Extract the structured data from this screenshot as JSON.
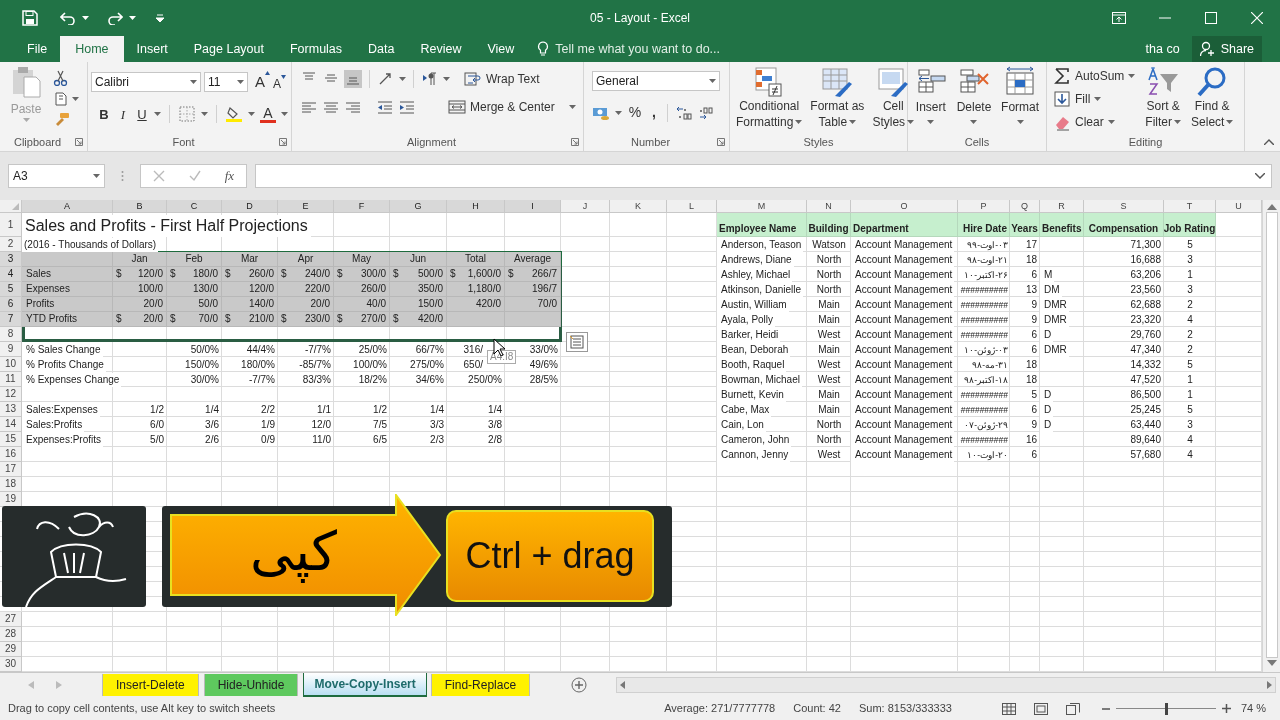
{
  "window": {
    "title": "05 - Layout - Excel"
  },
  "tabs": [
    {
      "label": "File",
      "selected": false
    },
    {
      "label": "Home",
      "selected": true
    },
    {
      "label": "Insert",
      "selected": false
    },
    {
      "label": "Page Layout",
      "selected": false
    },
    {
      "label": "Formulas",
      "selected": false
    },
    {
      "label": "Data",
      "selected": false
    },
    {
      "label": "Review",
      "selected": false
    },
    {
      "label": "View",
      "selected": false
    }
  ],
  "tell_me": {
    "placeholder": "Tell me what you want to do..."
  },
  "user": "tha co",
  "share": "Share",
  "ribbon": {
    "clipboard": {
      "label": "Clipboard",
      "paste": {
        "label": "Paste",
        "disabled": true
      }
    },
    "font": {
      "label": "Font",
      "font_name": "Calibri",
      "font_size": "11",
      "grow": "A",
      "shrink": "A",
      "bold": "B",
      "italic": "I",
      "underline": "U",
      "font_color": "A"
    },
    "alignment": {
      "label": "Alignment",
      "vertical": [
        {
          "selected": false
        },
        {
          "selected": false
        },
        {
          "selected": true
        }
      ],
      "wrap": "Wrap Text",
      "merge": "Merge & Center"
    },
    "number": {
      "label": "Number",
      "format": "General",
      "percent": "%",
      "comma": ","
    },
    "styles": {
      "label": "Styles",
      "buttons": [
        {
          "lines": [
            "Conditional",
            "Formatting"
          ]
        },
        {
          "lines": [
            "Format as",
            "Table"
          ]
        },
        {
          "lines": [
            "Cell",
            "Styles"
          ]
        }
      ]
    },
    "cells": {
      "label": "Cells",
      "buttons": [
        "Insert",
        "Delete",
        "Format"
      ]
    },
    "editing": {
      "label": "Editing",
      "autosum": "AutoSum",
      "fill": "Fill",
      "clear": "Clear",
      "big": [
        {
          "lines": [
            "Sort &",
            "Filter"
          ]
        },
        {
          "lines": [
            "Find &",
            "Select"
          ]
        }
      ]
    }
  },
  "formula_bar": {
    "name_box": "A3",
    "fx": "fx"
  },
  "sheet": {
    "columns": [
      {
        "letter": "A",
        "selected": true
      },
      {
        "letter": "B",
        "selected": true
      },
      {
        "letter": "C",
        "selected": true
      },
      {
        "letter": "D",
        "selected": true
      },
      {
        "letter": "E",
        "selected": true
      },
      {
        "letter": "F",
        "selected": true
      },
      {
        "letter": "G",
        "selected": true
      },
      {
        "letter": "H",
        "selected": true
      },
      {
        "letter": "I",
        "selected": true
      },
      {
        "letter": "J",
        "selected": false
      },
      {
        "letter": "K",
        "selected": false
      },
      {
        "letter": "L",
        "selected": false
      },
      {
        "letter": "M",
        "selected": false
      },
      {
        "letter": "N",
        "selected": false
      },
      {
        "letter": "O",
        "selected": false
      },
      {
        "letter": "P",
        "selected": false
      },
      {
        "letter": "Q",
        "selected": false
      },
      {
        "letter": "R",
        "selected": false
      },
      {
        "letter": "S",
        "selected": false
      },
      {
        "letter": "T",
        "selected": false
      },
      {
        "letter": "U",
        "selected": false
      }
    ],
    "rows": [
      {
        "header": "1",
        "selected": false,
        "cells": [
          {
            "kind": "title",
            "text": "Sales and Profits - First Half Projections"
          }
        ],
        "employee": [
          {
            "kind": "header",
            "text": "Employee Name"
          },
          {
            "kind": "header",
            "text": "Building"
          },
          {
            "kind": "header",
            "text": "Department"
          },
          {
            "kind": "header",
            "text": "Hire Date"
          },
          {
            "kind": "header",
            "text": "Years"
          },
          {
            "kind": "header",
            "text": "Benefits"
          },
          {
            "kind": "header",
            "text": "Compensation"
          },
          {
            "kind": "header",
            "text": "Job Rating"
          }
        ]
      },
      {
        "header": "2",
        "selected": false,
        "cells": [
          {
            "kind": "note",
            "text": "(2016 - Thousands of Dollars)"
          }
        ],
        "employee": [
          {
            "text": "Anderson, Teason"
          },
          {
            "text": "Watson"
          },
          {
            "text": "Account Management"
          },
          {
            "text": "۰۳-اوت-۹۹"
          },
          {
            "text": "17"
          },
          {
            "kind": "blank"
          },
          {
            "text": "71,300"
          },
          {
            "text": "5"
          }
        ]
      },
      {
        "header": "3",
        "selected": true,
        "cells": [
          {
            "kind": "blank"
          },
          {
            "kind": "center",
            "text": "Jan"
          },
          {
            "kind": "center",
            "text": "Feb"
          },
          {
            "kind": "center",
            "text": "Mar"
          },
          {
            "kind": "center",
            "text": "Apr"
          },
          {
            "kind": "center",
            "text": "May"
          },
          {
            "kind": "center",
            "text": "Jun"
          },
          {
            "kind": "center",
            "text": "Total"
          },
          {
            "kind": "center",
            "text": "Average"
          }
        ],
        "employee": [
          {
            "text": "Andrews, Diane"
          },
          {
            "text": "North"
          },
          {
            "text": "Account Management"
          },
          {
            "text": "۲۱-اوت-۹۸"
          },
          {
            "text": "18"
          },
          {
            "kind": "blank"
          },
          {
            "text": "16,688"
          },
          {
            "text": "3"
          }
        ]
      },
      {
        "header": "4",
        "selected": true,
        "cells": [
          {
            "kind": "label",
            "text": "Sales"
          },
          {
            "kind": "currency",
            "prefix": "$",
            "text": "120/0"
          },
          {
            "kind": "currency",
            "prefix": "$",
            "text": "180/0"
          },
          {
            "kind": "currency",
            "prefix": "$",
            "text": "260/0"
          },
          {
            "kind": "currency",
            "prefix": "$",
            "text": "240/0"
          },
          {
            "kind": "currency",
            "prefix": "$",
            "text": "300/0"
          },
          {
            "kind": "currency",
            "prefix": "$",
            "text": "500/0"
          },
          {
            "kind": "currency",
            "prefix": "$",
            "text": "1,600/0"
          },
          {
            "kind": "currency",
            "prefix": "$",
            "text": "266/7"
          }
        ],
        "employee": [
          {
            "text": "Ashley, Michael"
          },
          {
            "text": "North"
          },
          {
            "text": "Account Management"
          },
          {
            "text": "۲۶-اکتبر-۱۰"
          },
          {
            "text": "6"
          },
          {
            "text": "M"
          },
          {
            "text": "63,206"
          },
          {
            "text": "1"
          }
        ]
      },
      {
        "header": "5",
        "selected": true,
        "cells": [
          {
            "kind": "label",
            "text": "Expenses"
          },
          {
            "kind": "number",
            "text": "100/0"
          },
          {
            "kind": "number",
            "text": "130/0"
          },
          {
            "kind": "number",
            "text": "120/0"
          },
          {
            "kind": "number",
            "text": "220/0"
          },
          {
            "kind": "number",
            "text": "260/0"
          },
          {
            "kind": "number",
            "text": "350/0"
          },
          {
            "kind": "number",
            "text": "1,180/0"
          },
          {
            "kind": "number",
            "text": "196/7"
          }
        ],
        "employee": [
          {
            "text": "Atkinson, Danielle"
          },
          {
            "text": "North"
          },
          {
            "text": "Account Management"
          },
          {
            "text": "##########"
          },
          {
            "text": "13"
          },
          {
            "text": "DM"
          },
          {
            "text": "23,560"
          },
          {
            "text": "3"
          }
        ]
      },
      {
        "header": "6",
        "selected": true,
        "cells": [
          {
            "kind": "label",
            "text": "Profits"
          },
          {
            "kind": "number",
            "text": "20/0"
          },
          {
            "kind": "number",
            "text": "50/0"
          },
          {
            "kind": "number",
            "text": "140/0"
          },
          {
            "kind": "number",
            "text": "20/0"
          },
          {
            "kind": "number",
            "text": "40/0"
          },
          {
            "kind": "number",
            "text": "150/0"
          },
          {
            "kind": "number",
            "text": "420/0"
          },
          {
            "kind": "number",
            "text": "70/0"
          }
        ],
        "employee": [
          {
            "text": "Austin, William"
          },
          {
            "text": "Main"
          },
          {
            "text": "Account Management"
          },
          {
            "text": "##########"
          },
          {
            "text": "9"
          },
          {
            "text": "DMR"
          },
          {
            "text": "62,688"
          },
          {
            "text": "2"
          }
        ]
      },
      {
        "header": "7",
        "selected": true,
        "cells": [
          {
            "kind": "label",
            "text": "YTD Profits"
          },
          {
            "kind": "currency",
            "prefix": "$",
            "text": "20/0"
          },
          {
            "kind": "currency",
            "prefix": "$",
            "text": "70/0"
          },
          {
            "kind": "currency",
            "prefix": "$",
            "text": "210/0"
          },
          {
            "kind": "currency",
            "prefix": "$",
            "text": "230/0"
          },
          {
            "kind": "currency",
            "prefix": "$",
            "text": "270/0"
          },
          {
            "kind": "currency",
            "prefix": "$",
            "text": "420/0"
          }
        ],
        "employee": [
          {
            "text": "Ayala, Polly"
          },
          {
            "text": "Main"
          },
          {
            "text": "Account Management"
          },
          {
            "text": "##########"
          },
          {
            "text": "9"
          },
          {
            "text": "DMR"
          },
          {
            "text": "23,320"
          },
          {
            "text": "4"
          }
        ]
      },
      {
        "header": "8",
        "selected": false,
        "employee": [
          {
            "text": "Barker, Heidi"
          },
          {
            "text": "West"
          },
          {
            "text": "Account Management"
          },
          {
            "text": "##########"
          },
          {
            "text": "6"
          },
          {
            "text": "D"
          },
          {
            "text": "29,760"
          },
          {
            "text": "2"
          }
        ]
      },
      {
        "header": "9",
        "selected": false,
        "cells": [
          {
            "kind": "label",
            "text": "% Sales Change"
          },
          {
            "kind": "blank"
          },
          {
            "kind": "number",
            "text": "50/0%"
          },
          {
            "kind": "number",
            "text": "44/4%"
          },
          {
            "kind": "number",
            "text": "-7/7%"
          },
          {
            "kind": "number",
            "text": "25/0%"
          },
          {
            "kind": "number",
            "text": "66/7%"
          },
          {
            "kind": "partial",
            "text": "316/"
          },
          {
            "kind": "number",
            "text": "33/0%"
          }
        ],
        "employee": [
          {
            "text": "Bean, Deborah"
          },
          {
            "text": "Main"
          },
          {
            "text": "Account Management"
          },
          {
            "text": "۰۳-ژوئن-۱۰"
          },
          {
            "text": "6"
          },
          {
            "text": "DMR"
          },
          {
            "text": "47,340"
          },
          {
            "text": "2"
          }
        ]
      },
      {
        "header": "10",
        "selected": false,
        "cells": [
          {
            "kind": "label",
            "text": "% Profits Change"
          },
          {
            "kind": "blank"
          },
          {
            "kind": "number",
            "text": "150/0%"
          },
          {
            "kind": "number",
            "text": "180/0%"
          },
          {
            "kind": "number",
            "text": "-85/7%"
          },
          {
            "kind": "number",
            "text": "100/0%"
          },
          {
            "kind": "number",
            "text": "275/0%"
          },
          {
            "kind": "partial",
            "text": "650/"
          },
          {
            "kind": "number",
            "text": "49/6%"
          }
        ],
        "employee": [
          {
            "text": "Booth, Raquel"
          },
          {
            "text": "West"
          },
          {
            "text": "Account Management"
          },
          {
            "text": "۳۱-مه-۹۸"
          },
          {
            "text": "18"
          },
          {
            "kind": "blank"
          },
          {
            "text": "14,332"
          },
          {
            "text": "5"
          }
        ]
      },
      {
        "header": "11",
        "selected": false,
        "cells": [
          {
            "kind": "label",
            "text": "% Expenses Change"
          },
          {
            "kind": "blank"
          },
          {
            "kind": "number",
            "text": "30/0%"
          },
          {
            "kind": "number",
            "text": "-7/7%"
          },
          {
            "kind": "number",
            "text": "83/3%"
          },
          {
            "kind": "number",
            "text": "18/2%"
          },
          {
            "kind": "number",
            "text": "34/6%"
          },
          {
            "kind": "number",
            "text": "250/0%"
          },
          {
            "kind": "number",
            "text": "28/5%"
          }
        ],
        "employee": [
          {
            "text": "Bowman, Michael"
          },
          {
            "text": "West"
          },
          {
            "text": "Account Management"
          },
          {
            "text": "۱۸-اکتبر-۹۸"
          },
          {
            "text": "18"
          },
          {
            "kind": "blank"
          },
          {
            "text": "47,520"
          },
          {
            "text": "1"
          }
        ]
      },
      {
        "header": "12",
        "selected": false,
        "employee": [
          {
            "text": "Burnett, Kevin"
          },
          {
            "text": "Main"
          },
          {
            "text": "Account Management"
          },
          {
            "text": "##########"
          },
          {
            "text": "5"
          },
          {
            "text": "D"
          },
          {
            "text": "86,500"
          },
          {
            "text": "1"
          }
        ]
      },
      {
        "header": "13",
        "selected": false,
        "cells": [
          {
            "kind": "label",
            "text": "Sales:Expenses"
          },
          {
            "kind": "number",
            "text": "1/2"
          },
          {
            "kind": "number",
            "text": "1/4"
          },
          {
            "kind": "number",
            "text": "2/2"
          },
          {
            "kind": "number",
            "text": "1/1"
          },
          {
            "kind": "number",
            "text": "1/2"
          },
          {
            "kind": "number",
            "text": "1/4"
          },
          {
            "kind": "number",
            "text": "1/4"
          }
        ],
        "employee": [
          {
            "text": "Cabe, Max"
          },
          {
            "text": "Main"
          },
          {
            "text": "Account Management"
          },
          {
            "text": "##########"
          },
          {
            "text": "6"
          },
          {
            "text": "D"
          },
          {
            "text": "25,245"
          },
          {
            "text": "5"
          }
        ]
      },
      {
        "header": "14",
        "selected": false,
        "cells": [
          {
            "kind": "label",
            "text": "Sales:Profits"
          },
          {
            "kind": "number",
            "text": "6/0"
          },
          {
            "kind": "number",
            "text": "3/6"
          },
          {
            "kind": "number",
            "text": "1/9"
          },
          {
            "kind": "number",
            "text": "12/0"
          },
          {
            "kind": "number",
            "text": "7/5"
          },
          {
            "kind": "number",
            "text": "3/3"
          },
          {
            "kind": "number",
            "text": "3/8"
          }
        ],
        "employee": [
          {
            "text": "Cain, Lon"
          },
          {
            "text": "North"
          },
          {
            "text": "Account Management"
          },
          {
            "text": "۲۹-ژوئن-۰۷"
          },
          {
            "text": "9"
          },
          {
            "text": "D"
          },
          {
            "text": "63,440"
          },
          {
            "text": "3"
          }
        ]
      },
      {
        "header": "15",
        "selected": false,
        "cells": [
          {
            "kind": "label",
            "text": "Expenses:Profits"
          },
          {
            "kind": "number",
            "text": "5/0"
          },
          {
            "kind": "number",
            "text": "2/6"
          },
          {
            "kind": "number",
            "text": "0/9"
          },
          {
            "kind": "number",
            "text": "11/0"
          },
          {
            "kind": "number",
            "text": "6/5"
          },
          {
            "kind": "number",
            "text": "2/3"
          },
          {
            "kind": "number",
            "text": "2/8"
          }
        ],
        "employee": [
          {
            "text": "Cameron, John"
          },
          {
            "text": "North"
          },
          {
            "text": "Account Management"
          },
          {
            "text": "##########"
          },
          {
            "text": "16"
          },
          {
            "kind": "blank"
          },
          {
            "text": "89,640"
          },
          {
            "text": "4"
          }
        ]
      },
      {
        "header": "16",
        "selected": false,
        "employee": [
          {
            "text": "Cannon, Jenny"
          },
          {
            "text": "West"
          },
          {
            "text": "Account Management"
          },
          {
            "text": "۲۰-اوت-۱۰"
          },
          {
            "text": "6"
          },
          {
            "kind": "blank"
          },
          {
            "text": "57,680"
          },
          {
            "text": "4"
          }
        ]
      },
      {
        "header": "17",
        "selected": false
      },
      {
        "header": "18",
        "selected": false
      },
      {
        "header": "19",
        "selected": false
      },
      {
        "kind": "covered"
      },
      {
        "kind": "covered"
      },
      {
        "kind": "covered"
      },
      {
        "kind": "covered"
      },
      {
        "kind": "covered"
      },
      {
        "kind": "covered"
      },
      {
        "kind": "covered"
      },
      {
        "header": "27",
        "selected": false
      },
      {
        "header": "28",
        "selected": false
      },
      {
        "header": "29",
        "selected": false
      },
      {
        "header": "30",
        "selected": false
      }
    ],
    "drag_tooltip": "A4:I8"
  },
  "sheet_tabs": [
    {
      "label": "Insert-Delete",
      "color": "#fff200",
      "selected": false
    },
    {
      "label": "Hide-Unhide",
      "color": "#5ec95e",
      "selected": false
    },
    {
      "label": "Move-Copy-Insert",
      "color": "#b9dff2",
      "selected": true
    },
    {
      "label": "Find-Replace",
      "color": "#fff200",
      "selected": false
    }
  ],
  "status_bar": {
    "message": "Drag to copy cell contents, use Alt key to switch sheets",
    "average": "Average: 271/7777778",
    "count": "Count: 42",
    "sum": "Sum: 8153/333333",
    "zoom": {
      "level": 0.5,
      "reading": "74 %"
    }
  },
  "overlay": {
    "caption": "کپی",
    "shortcut": "Ctrl + drag"
  }
}
